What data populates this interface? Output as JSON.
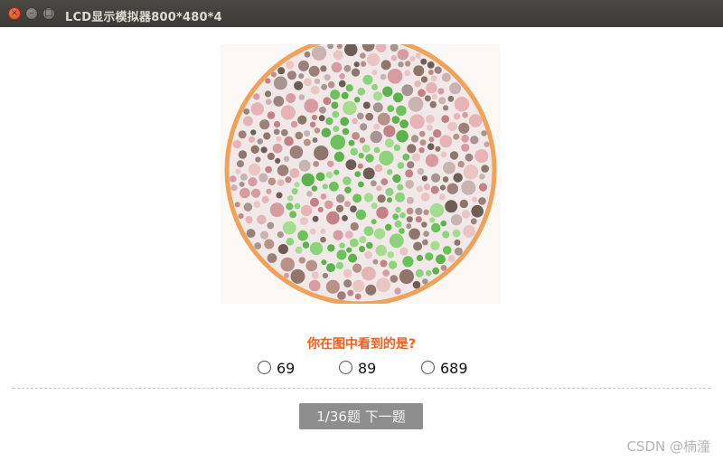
{
  "window": {
    "title": "LCD显示模拟器800*480*4",
    "close_glyph": "×",
    "min_glyph": "–",
    "max_glyph": "□"
  },
  "plate": {
    "ring_color": "#efa35a",
    "background_dot_colors": [
      "#d79ba2",
      "#e6b3b6",
      "#c48188",
      "#b89189",
      "#8f766b",
      "#6e5d56",
      "#c9b4b2",
      "#a79490",
      "#e9c5c4",
      "#9c807a"
    ],
    "figure_dot_colors": [
      "#6cc25a",
      "#8bd47c",
      "#5cb24c",
      "#a6dc90"
    ]
  },
  "quiz": {
    "question": "你在图中看到的是?",
    "options": [
      {
        "label": "69",
        "selected": false
      },
      {
        "label": "89",
        "selected": false
      },
      {
        "label": "689",
        "selected": false
      }
    ],
    "next_button": "1/36题 下一题"
  },
  "watermark": "CSDN @楠潼"
}
